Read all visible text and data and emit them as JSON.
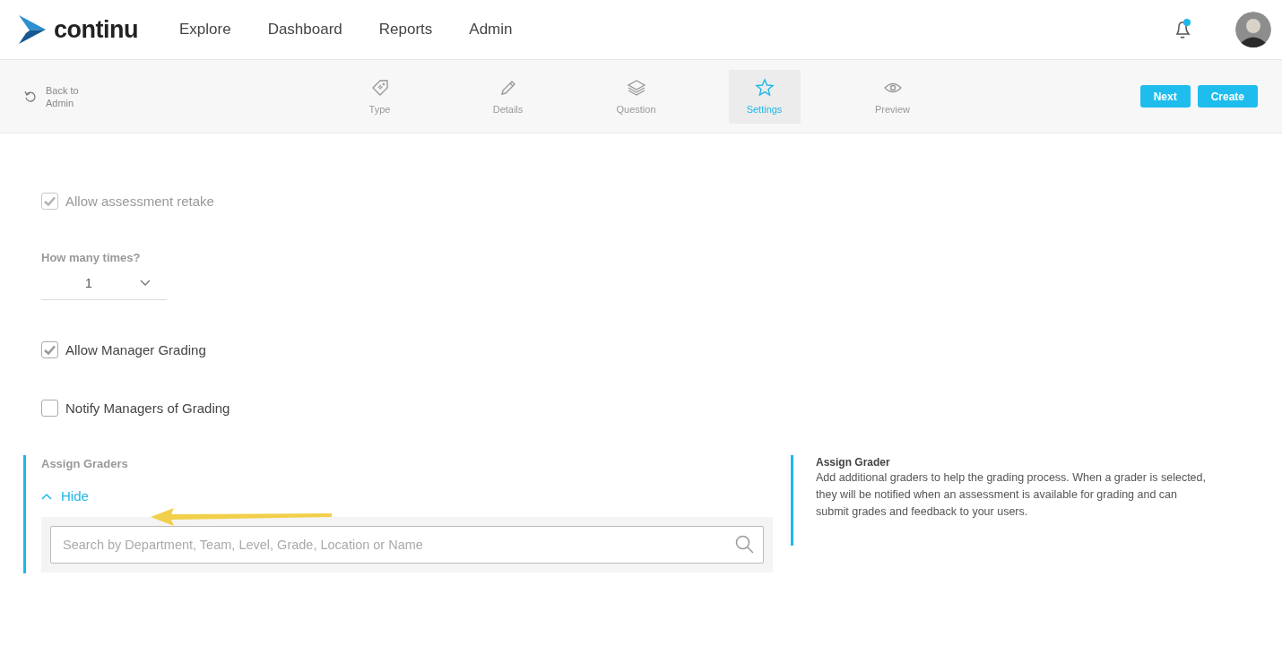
{
  "brand": {
    "name": "continu"
  },
  "nav": [
    {
      "label": "Explore"
    },
    {
      "label": "Dashboard"
    },
    {
      "label": "Reports"
    },
    {
      "label": "Admin"
    }
  ],
  "notifications": {
    "unread": true
  },
  "toolbar": {
    "back": "Back to Admin",
    "steps": [
      {
        "label": "Type",
        "selected": false
      },
      {
        "label": "Details",
        "selected": false
      },
      {
        "label": "Question",
        "selected": false
      },
      {
        "label": "Settings",
        "selected": true
      },
      {
        "label": "Preview",
        "selected": false
      }
    ],
    "buttons": [
      "Next",
      "Create"
    ]
  },
  "settings": [
    {
      "kind": "checkbox",
      "label": "Allow assessment retake",
      "checked": true,
      "disabled": true
    },
    {
      "kind": "select",
      "label": "How many times?",
      "value": "1"
    },
    {
      "kind": "checkbox",
      "label": "Allow Manager Grading",
      "checked": true,
      "disabled": false
    },
    {
      "kind": "checkbox",
      "label": "Notify Managers of Grading",
      "checked": false,
      "disabled": false
    }
  ],
  "assign": {
    "title": "Assign Graders",
    "toggle": "Hide",
    "expanded": true,
    "search": {
      "placeholder": "Search by Department, Team, Level, Grade, Location or Name"
    }
  },
  "help": {
    "title": "Assign Grader",
    "text": "Add additional graders to help the grading process. When a grader is selected, they will be notified when an assessment is available for grading and can submit grades and feedback to your users."
  }
}
